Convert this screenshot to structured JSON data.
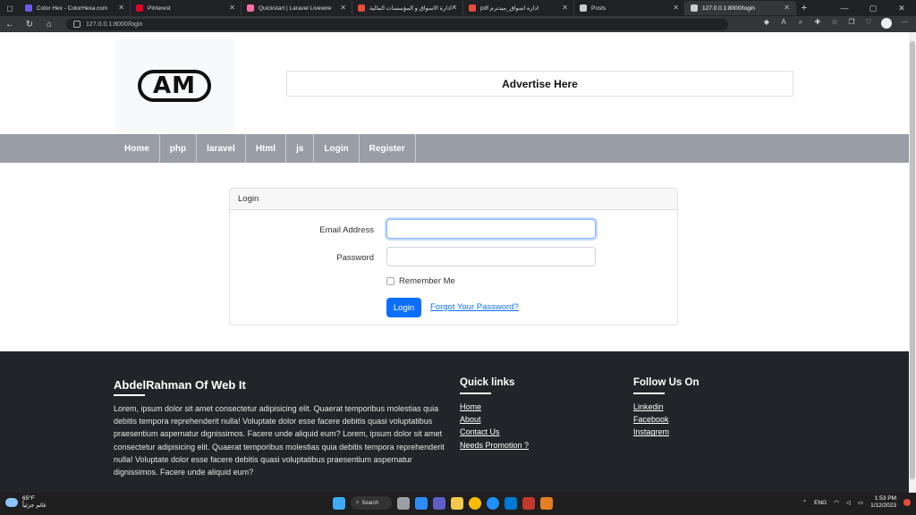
{
  "browser": {
    "tabs": [
      {
        "title": "Color Hex - ColorHexa.com",
        "color": "#6c5ce7"
      },
      {
        "title": "Pinterest",
        "color": "#e60023"
      },
      {
        "title": "Quickstart | Laravel Livewire",
        "color": "#fb70a9"
      },
      {
        "title": "ادارة الاسواق و المؤسسات المالية",
        "color": "#e74c3c"
      },
      {
        "title": "pdf اداره اسواق_ميدترم",
        "color": "#e74c3c"
      },
      {
        "title": "Posts",
        "color": "#cccccc"
      },
      {
        "title": "127.0.0.1:8000/login",
        "color": "#cccccc"
      }
    ],
    "active_tab_index": 6,
    "url": "127.0.0.1:8000/login"
  },
  "header": {
    "logo_text": "AM",
    "advertise": "Advertise Here"
  },
  "nav": {
    "items": [
      "Home",
      "php",
      "laravel",
      "Html",
      "js",
      "Login",
      "Register"
    ]
  },
  "login": {
    "card_title": "Login",
    "email_label": "Email Address",
    "email_value": "",
    "password_label": "Password",
    "password_value": "",
    "remember_label": "Remember Me",
    "submit_label": "Login",
    "forgot_label": "Forgot Your Password?"
  },
  "footer": {
    "brand": "AbdelRahman Of Web It",
    "about_text": "Lorem, ipsum dolor sit amet consectetur adipisicing elit. Quaerat temporibus molestias quia debitis tempora reprehenderit nulla! Voluptate dolor esse facere debitis quasi voluptatibus praesentium aspernatur dignissimos. Facere unde aliquid eum? Lorem, ipsum dolor sit amet consectetur adipisicing elit. Quaerat temporibus molestias quia debitis tempora reprehenderit nulla! Voluptate dolor esse facere debitis quasi voluptatibus praesentium aspernatur dignissimos. Facere unde aliquid eum?",
    "quick_links_title": "Quick links",
    "quick_links": [
      "Home",
      "About",
      "Contact Us",
      "Needs Promotion ?"
    ],
    "follow_title": "Follow Us On",
    "follow_links": [
      "Linkedin",
      "Facebook",
      "Instagrem"
    ]
  },
  "taskbar": {
    "temperature": "65°F",
    "weather_desc": "غائم جزئياً",
    "search_label": "Search",
    "language": "ENG",
    "time": "1:53 PM",
    "date": "1/12/2023"
  }
}
